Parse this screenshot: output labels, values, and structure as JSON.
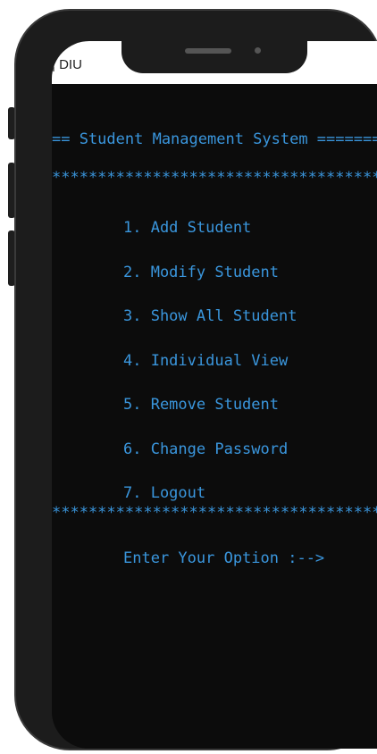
{
  "window": {
    "title": "| DIU"
  },
  "console": {
    "header": "== Student Management System ================",
    "separator_top": "**********************************************",
    "menu": [
      "1. Add Student",
      "2. Modify Student",
      "3. Show All Student",
      "4. Individual View",
      "5. Remove Student",
      "6. Change Password",
      "7. Logout"
    ],
    "separator_bottom": "**********************************************",
    "prompt": "Enter Your Option :-->"
  },
  "colors": {
    "console_background": "#0c0c0c",
    "console_text": "#3a96dd",
    "phone_frame": "#1c1c1c",
    "titlebar": "#ffffff"
  }
}
